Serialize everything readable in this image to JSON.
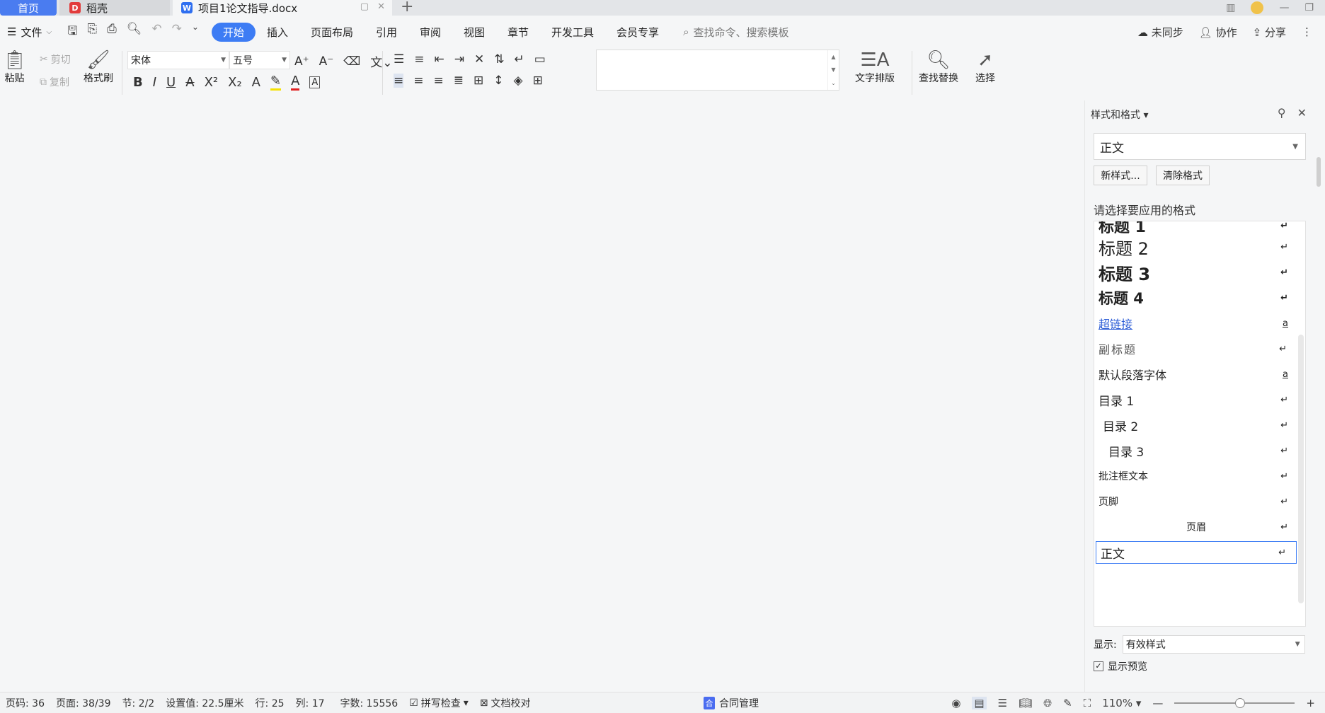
{
  "tabs": {
    "home": "首页",
    "daoke": "稻壳",
    "doc": "项目1论文指导.docx"
  },
  "menu": {
    "file": "文件",
    "tabs": [
      "开始",
      "插入",
      "页面布局",
      "引用",
      "审阅",
      "视图",
      "章节",
      "开发工具",
      "会员专享"
    ],
    "search_placeholder": "查找命令、搜索模板",
    "right": {
      "sync": "未同步",
      "collab": "协作",
      "share": "分享"
    }
  },
  "ribbon": {
    "paste": "粘贴",
    "cut": "剪切",
    "copy": "复制",
    "format_painter": "格式刷",
    "font_name": "宋体",
    "font_size": "五号",
    "text_layout": "文字排版",
    "find_replace": "查找替换",
    "select": "选择"
  },
  "panel": {
    "title": "样式和格式",
    "current_style": "正文",
    "new_style": "新样式...",
    "clear_format": "清除格式",
    "apply_label": "请选择要应用的格式",
    "styles": [
      {
        "name": "标题 1"
      },
      {
        "name": "标题 2"
      },
      {
        "name": "标题 3"
      },
      {
        "name": "标题 4"
      },
      {
        "name": "超链接"
      },
      {
        "name": "副标题"
      },
      {
        "name": "默认段落字体"
      },
      {
        "name": "目录 1"
      },
      {
        "name": "目录 2"
      },
      {
        "name": "目录 3"
      },
      {
        "name": "批注框文本"
      },
      {
        "name": "页脚"
      },
      {
        "name": "页眉"
      },
      {
        "name": "正文"
      }
    ],
    "show_label": "显示:",
    "show_value": "有效样式",
    "preview_label": "显示预览"
  },
  "status": {
    "page_code": "页码: 36",
    "pages": "页面: 38/39",
    "section": "节: 2/2",
    "setting": "设置值: 22.5厘米",
    "row": "行: 25",
    "col": "列: 17",
    "words": "字数: 15556",
    "spellcheck": "拼写检查",
    "proofread": "文档校对",
    "contract": "合同管理",
    "zoom": "110%"
  }
}
